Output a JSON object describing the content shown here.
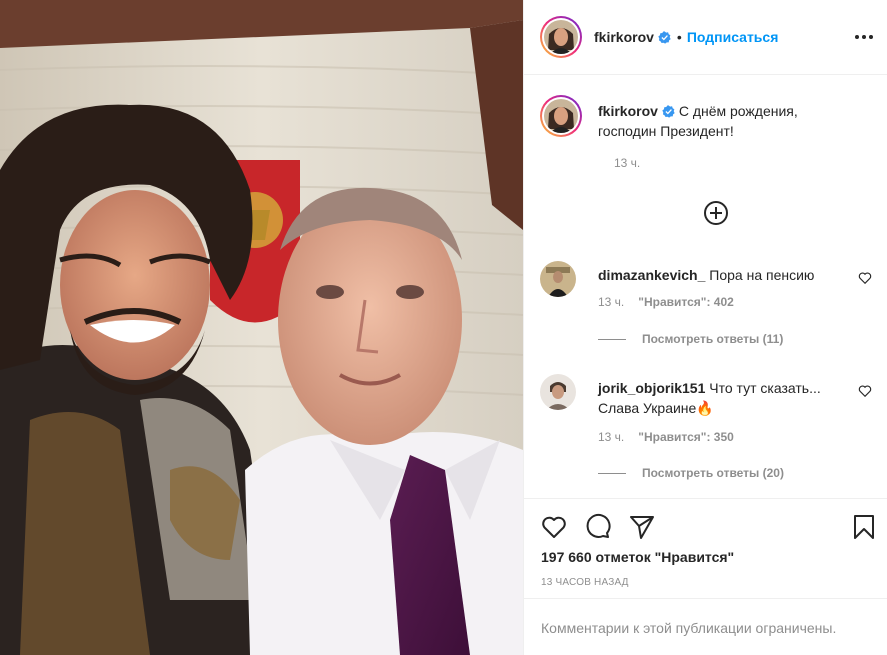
{
  "header": {
    "username": "fkirkorov",
    "separator": "•",
    "follow_label": "Подписаться"
  },
  "caption": {
    "username": "fkirkorov",
    "text": "С днём рождения, господин Президент!",
    "time": "13 ч."
  },
  "comments": [
    {
      "username": "dimazankevich_",
      "text": "Пора на пенсию",
      "time": "13 ч.",
      "likes": "\"Нравится\": 402",
      "replies": "Посмотреть ответы (11)"
    },
    {
      "username": "jorik_objorik151",
      "text": "Что тут сказать... Слава Украине🔥",
      "time": "13 ч.",
      "likes": "\"Нравится\": 350",
      "replies": "Посмотреть ответы (20)"
    }
  ],
  "stats": {
    "likes": "197 660 отметок \"Нравится\"",
    "posted": "13 ЧАСОВ НАЗАД"
  },
  "footer": {
    "notice": "Комментарии к этой публикации ограничены."
  },
  "icons": {
    "verified": "verified-badge-icon",
    "more": "more-options-icon",
    "add": "load-more-comments-icon",
    "like": "heart-icon",
    "comment": "comment-bubble-icon",
    "share": "paper-plane-icon",
    "save": "bookmark-icon"
  },
  "colors": {
    "accent": "#0095f6",
    "text": "#262626",
    "muted": "#8e8e8e",
    "border": "#efefef"
  }
}
